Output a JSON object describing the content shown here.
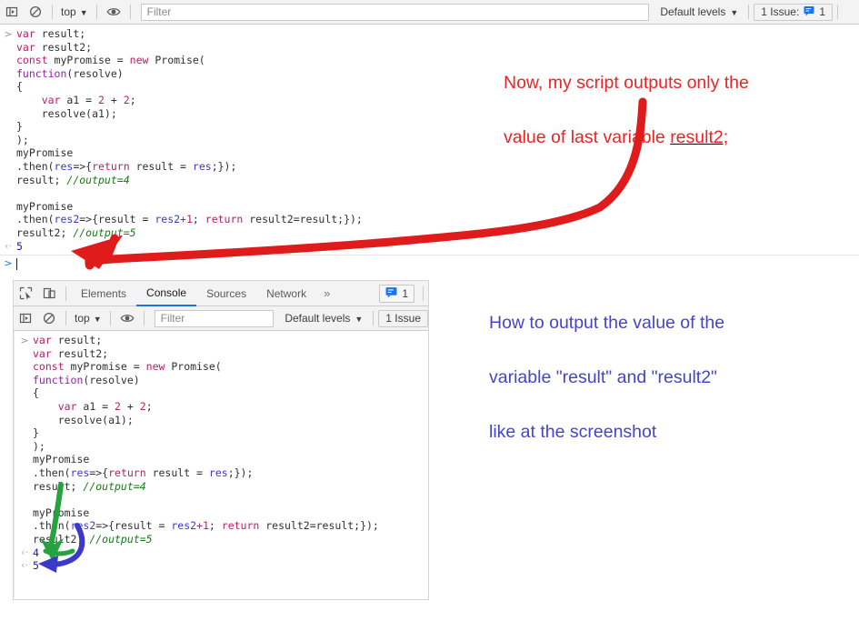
{
  "top_panel": {
    "toolbar": {
      "sidebar_toggle_icon": "console-sidebar-icon",
      "clear_icon": "clear-console-icon",
      "context_label": "top",
      "context_caret": "▼",
      "eye_icon": "live-expression-eye-icon",
      "filter_placeholder": "Filter",
      "filter_value": "",
      "levels_label": "Default levels",
      "levels_caret": "▼",
      "issues_label": "1 Issue:",
      "issues_icon": "issues-message-icon",
      "issues_count": "1"
    },
    "console": {
      "prompt_glyph": ">",
      "code_lines": [
        [
          {
            "t": "kw",
            "s": "var"
          },
          {
            "t": "plain",
            "s": " result;"
          }
        ],
        [
          {
            "t": "kw",
            "s": "var"
          },
          {
            "t": "plain",
            "s": " result2;"
          }
        ],
        [
          {
            "t": "kw",
            "s": "const"
          },
          {
            "t": "plain",
            "s": " myPromise = "
          },
          {
            "t": "kw",
            "s": "new"
          },
          {
            "t": "plain",
            "s": " Promise("
          }
        ],
        [
          {
            "t": "fn",
            "s": "function"
          },
          {
            "t": "plain",
            "s": "(resolve)"
          }
        ],
        [
          {
            "t": "plain",
            "s": "{"
          }
        ],
        [
          {
            "t": "plain",
            "s": "    "
          },
          {
            "t": "kw",
            "s": "var"
          },
          {
            "t": "plain",
            "s": " a1 = "
          },
          {
            "t": "num",
            "s": "2"
          },
          {
            "t": "plain",
            "s": " + "
          },
          {
            "t": "num",
            "s": "2"
          },
          {
            "t": "plain",
            "s": ";"
          }
        ],
        [
          {
            "t": "plain",
            "s": "    resolve(a1);"
          }
        ],
        [
          {
            "t": "plain",
            "s": "}"
          }
        ],
        [
          {
            "t": "plain",
            "s": ");"
          }
        ],
        [
          {
            "t": "plain",
            "s": "myPromise"
          }
        ],
        [
          {
            "t": "plain",
            "s": ".then("
          },
          {
            "t": "param",
            "s": "res"
          },
          {
            "t": "plain",
            "s": "=>{"
          },
          {
            "t": "kw",
            "s": "return"
          },
          {
            "t": "plain",
            "s": " result = "
          },
          {
            "t": "param",
            "s": "res"
          },
          {
            "t": "plain",
            "s": ";});"
          }
        ],
        [
          {
            "t": "plain",
            "s": "result; "
          },
          {
            "t": "cmt",
            "s": "//output=4"
          }
        ],
        [
          {
            "t": "plain",
            "s": ""
          }
        ],
        [
          {
            "t": "plain",
            "s": "myPromise"
          }
        ],
        [
          {
            "t": "plain",
            "s": ".then("
          },
          {
            "t": "param",
            "s": "res2"
          },
          {
            "t": "plain",
            "s": "=>{result = "
          },
          {
            "t": "param",
            "s": "res2"
          },
          {
            "t": "num",
            "s": "+1"
          },
          {
            "t": "plain",
            "s": "; "
          },
          {
            "t": "kw",
            "s": "return"
          },
          {
            "t": "plain",
            "s": " result2=result;});"
          }
        ],
        [
          {
            "t": "plain",
            "s": "result2; "
          },
          {
            "t": "cmt",
            "s": "//output=5"
          }
        ]
      ],
      "outputs": [
        {
          "glyph": "‹·",
          "value": "5"
        }
      ],
      "input_prompt_glyph": ">",
      "input_value": ""
    }
  },
  "inner_window": {
    "tabs_bar": {
      "inspect_icon": "inspect-element-icon",
      "device_icon": "device-toolbar-icon",
      "tabs": [
        {
          "label": "Elements",
          "active": false
        },
        {
          "label": "Console",
          "active": true
        },
        {
          "label": "Sources",
          "active": false
        },
        {
          "label": "Network",
          "active": false
        }
      ],
      "more_tabs_glyph": "»",
      "messages_icon": "issues-message-icon",
      "messages_count": "1"
    },
    "toolbar": {
      "sidebar_toggle_icon": "console-sidebar-icon",
      "clear_icon": "clear-console-icon",
      "context_label": "top",
      "context_caret": "▼",
      "eye_icon": "live-expression-eye-icon",
      "filter_placeholder": "Filter",
      "filter_value": "",
      "levels_label": "Default levels",
      "levels_caret": "▼",
      "issues_label": "1 Issue"
    },
    "console": {
      "prompt_glyph": ">",
      "code_lines": [
        [
          {
            "t": "kw",
            "s": "var"
          },
          {
            "t": "plain",
            "s": " result;"
          }
        ],
        [
          {
            "t": "kw",
            "s": "var"
          },
          {
            "t": "plain",
            "s": " result2;"
          }
        ],
        [
          {
            "t": "kw",
            "s": "const"
          },
          {
            "t": "plain",
            "s": " myPromise = "
          },
          {
            "t": "kw",
            "s": "new"
          },
          {
            "t": "plain",
            "s": " Promise("
          }
        ],
        [
          {
            "t": "fn",
            "s": "function"
          },
          {
            "t": "plain",
            "s": "(resolve)"
          }
        ],
        [
          {
            "t": "plain",
            "s": "{"
          }
        ],
        [
          {
            "t": "plain",
            "s": "    "
          },
          {
            "t": "kw",
            "s": "var"
          },
          {
            "t": "plain",
            "s": " a1 = "
          },
          {
            "t": "num",
            "s": "2"
          },
          {
            "t": "plain",
            "s": " + "
          },
          {
            "t": "num",
            "s": "2"
          },
          {
            "t": "plain",
            "s": ";"
          }
        ],
        [
          {
            "t": "plain",
            "s": "    resolve(a1);"
          }
        ],
        [
          {
            "t": "plain",
            "s": "}"
          }
        ],
        [
          {
            "t": "plain",
            "s": ");"
          }
        ],
        [
          {
            "t": "plain",
            "s": "myPromise"
          }
        ],
        [
          {
            "t": "plain",
            "s": ".then("
          },
          {
            "t": "param",
            "s": "res"
          },
          {
            "t": "plain",
            "s": "=>{"
          },
          {
            "t": "kw",
            "s": "return"
          },
          {
            "t": "plain",
            "s": " result = "
          },
          {
            "t": "param",
            "s": "res"
          },
          {
            "t": "plain",
            "s": ";});"
          }
        ],
        [
          {
            "t": "plain",
            "s": "result; "
          },
          {
            "t": "cmt",
            "s": "//output=4"
          }
        ],
        [
          {
            "t": "plain",
            "s": ""
          }
        ],
        [
          {
            "t": "plain",
            "s": "myPromise"
          }
        ],
        [
          {
            "t": "plain",
            "s": ".then("
          },
          {
            "t": "param",
            "s": "res2"
          },
          {
            "t": "plain",
            "s": "=>{result = "
          },
          {
            "t": "param",
            "s": "res2"
          },
          {
            "t": "num",
            "s": "+1"
          },
          {
            "t": "plain",
            "s": "; "
          },
          {
            "t": "kw",
            "s": "return"
          },
          {
            "t": "plain",
            "s": " result2=result;});"
          }
        ],
        [
          {
            "t": "plain",
            "s": "result2; "
          },
          {
            "t": "cmt",
            "s": "//output=5"
          }
        ]
      ],
      "outputs": [
        {
          "glyph": "‹·",
          "value": "4"
        },
        {
          "glyph": "‹·",
          "value": "5"
        }
      ]
    }
  },
  "annotations": {
    "red_note": {
      "line1": "Now, my script outputs only the",
      "line2_prefix": "value of last variable ",
      "line2_underlined": "result2;",
      "color": "#ee2222",
      "underline_color": "#111111"
    },
    "blue_note": {
      "line1": "How to output the value of the",
      "line2": "variable \"result\" and \"result2\"",
      "line3": "like at the screenshot",
      "color": "#4444cc"
    },
    "arrows": [
      {
        "name": "red-arrow",
        "color": "#e01b1b",
        "from": "red note",
        "to": "console output line 5"
      },
      {
        "name": "green-arrow",
        "color": "#24a33f",
        "from": "result; //output=4",
        "to": "output 4"
      },
      {
        "name": "blue-arrow",
        "color": "#3b39c9",
        "from": "result2; //output=5",
        "to": "output 5"
      }
    ]
  }
}
